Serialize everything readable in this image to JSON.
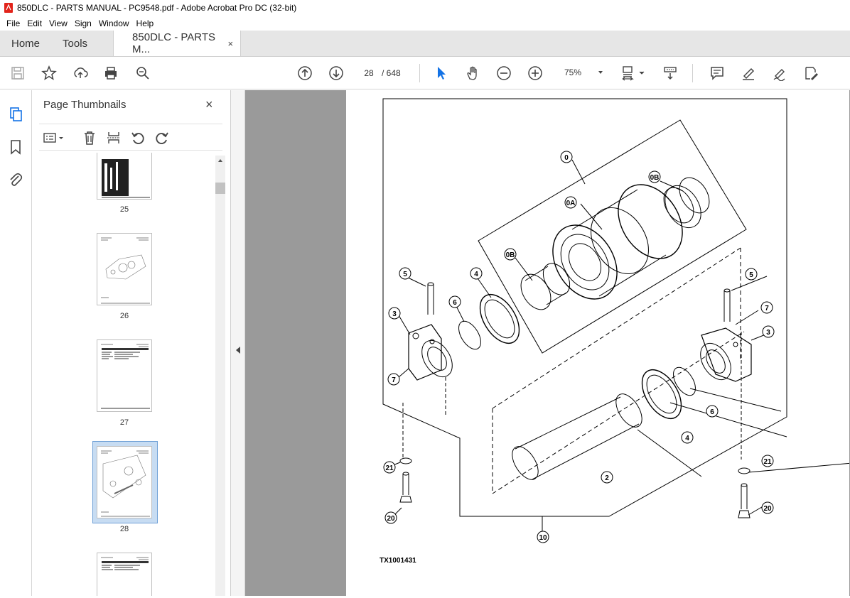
{
  "window": {
    "title": "850DLC - PARTS MANUAL - PC9548.pdf - Adobe Acrobat Pro DC (32-bit)"
  },
  "menu": [
    "File",
    "Edit",
    "View",
    "Sign",
    "Window",
    "Help"
  ],
  "tabs": {
    "home": "Home",
    "tools": "Tools",
    "document": "850DLC - PARTS M...",
    "close": "×"
  },
  "toolbar": {
    "current_page": "28",
    "total_pages": "/ 648",
    "zoom": "75%",
    "icons": [
      "save-icon",
      "star-icon",
      "upload-icon",
      "print-icon",
      "search-icon",
      "page-up-icon",
      "page-down-icon",
      "select-cursor-icon",
      "hand-icon",
      "zoom-out-icon",
      "zoom-in-icon",
      "fit-page-icon",
      "scroll-mode-icon",
      "comment-icon",
      "highlight-icon",
      "sign-icon",
      "edit-pdf-icon"
    ]
  },
  "panel": {
    "title": "Page Thumbnails",
    "close": "×",
    "thumbnails": [
      {
        "label": "25",
        "selected": false
      },
      {
        "label": "26",
        "selected": false
      },
      {
        "label": "27",
        "selected": false
      },
      {
        "label": "28",
        "selected": true
      },
      {
        "label": "",
        "selected": false
      }
    ]
  },
  "figure": {
    "code": "TX1001431",
    "callouts": [
      "0",
      "0A",
      "0B",
      "0B",
      "2",
      "3",
      "3",
      "4",
      "4",
      "5",
      "5",
      "6",
      "6",
      "7",
      "7",
      "10",
      "20",
      "20",
      "21",
      "21"
    ]
  },
  "colors": {
    "accent": "#1473e6",
    "tabbar": "#e6e6e6",
    "viewer_bg": "#9a9a9a",
    "selection": "#c7dcf2"
  }
}
